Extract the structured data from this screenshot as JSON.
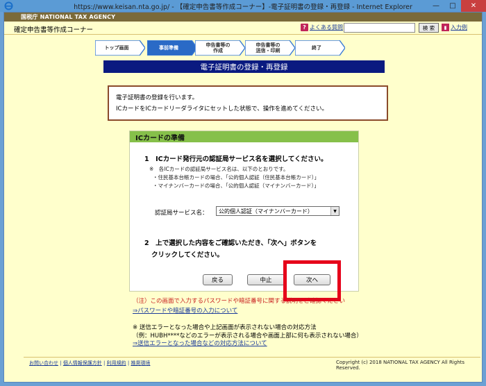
{
  "window": {
    "title": "https://www.keisan.nta.go.jp/ - 【確定申告書等作成コーナー】-電子証明書の登録・再登録 - Internet Explorer",
    "minimize": "—",
    "maximize": "□",
    "close": "✕"
  },
  "header": {
    "agency_logo": "国税庁  NATIONAL TAX AGENCY",
    "site_name": "確定申告書等作成コーナー",
    "faq_label": "よくある質問",
    "search_value": "",
    "search_button": "検 索",
    "entry_label": "入力例"
  },
  "steps": [
    {
      "label": "トップ画面"
    },
    {
      "label": "事前準備"
    },
    {
      "label": "申告書等の\n作成"
    },
    {
      "label": "申告書等の\n送信・印刷"
    },
    {
      "label": "終了"
    }
  ],
  "page_title": "電子証明書の登録・再登録",
  "notice": {
    "line1": "電子証明書の登録を行います。",
    "line2": "ICカードをICカードリーダライタにセットした状態で、操作を進めてください。"
  },
  "panel": {
    "heading": "ICカードの準備",
    "q1": "1　ICカード発行元の認証局サービス名を選択してください。",
    "note1": "※　各ICカードの認証局サービス名は、以下のとおりです。",
    "note2": "・住民基本台帳カードの場合、「公的個人認証（住民基本台帳カード）」",
    "note3": "・マイナンバーカードの場合、「公的個人認証（マイナンバーカード）」",
    "cert_label": "認証局サービス名：",
    "cert_value": "公的個人認証（マイナンバーカード）",
    "q2_line1": "2　上で選択した内容をご確認いただき、「次へ」ボタンを",
    "q2_line2": "クリックしてください。",
    "back": "戻る",
    "stop": "中止",
    "next": "次へ"
  },
  "warning": "（注）この画面で入力するパスワードや暗証番号に関する説明をご確認ください",
  "pw_link": "⇒パスワードや暗証番号の入力について",
  "error_note": {
    "line1": "※ 送信エラーとなった場合や上記画面が表示されない場合の対応方法",
    "line2": "（例：HUBH****などのエラーが表示される場合や画面上部に何も表示されない場合）",
    "link": "⇒送信エラーとなった場合などの対応方法について"
  },
  "footer": {
    "contact": "お問い合わせ",
    "privacy": "個人情報保護方針",
    "terms": "利用規約",
    "env": "推奨環境",
    "copyright": "Copyright (c) 2018 NATIONAL TAX AGENCY All Rights Reserved."
  },
  "colors": {
    "title_bar": "#0a1a80",
    "panel_head": "#86c04a",
    "highlight": "#e6001a",
    "background": "#ffffcc"
  }
}
